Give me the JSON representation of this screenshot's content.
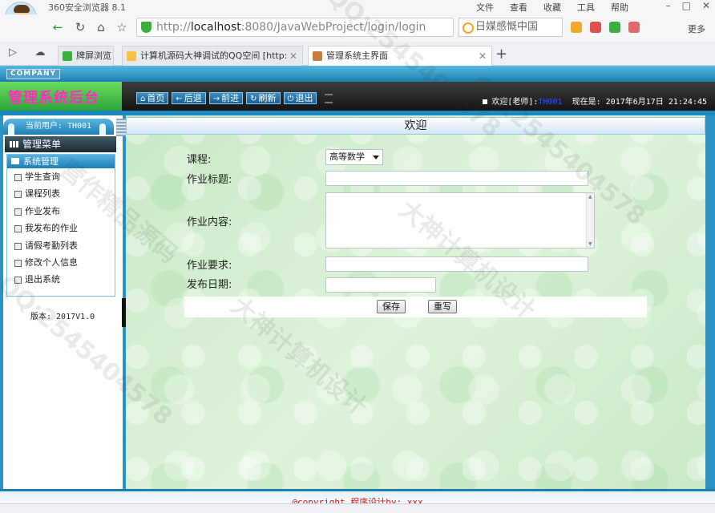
{
  "browser": {
    "title": "360安全浏览器 8.1",
    "menu": [
      "文件",
      "查看",
      "收藏",
      "工具",
      "帮助"
    ],
    "url_scheme": "http://",
    "url_host": "localhost",
    "url_rest": ":8080/JavaWebProject/login/login",
    "search_text": "日媒感慨中国",
    "more_label": "更多",
    "tabs": [
      {
        "label": "牌屏浏览"
      },
      {
        "label": "计算机源码大神调试的QQ空间 [http:"
      },
      {
        "label": "管理系统主界面"
      }
    ]
  },
  "app": {
    "company_badge": "COMPANY",
    "title": "管理系统后台",
    "nav_buttons": [
      {
        "label": "首页",
        "glyph": "⌂"
      },
      {
        "label": "后退",
        "glyph": "←"
      },
      {
        "label": "前进",
        "glyph": "→"
      },
      {
        "label": "刷新",
        "glyph": "↻"
      },
      {
        "label": "退出",
        "glyph": "⏻"
      }
    ],
    "welcome_prefix": "欢迎[老师]:",
    "welcome_user": "TH001",
    "time_label": "现在是: 2017年6月17日 21:24:45"
  },
  "sidebar": {
    "current_user": "当前用户: TH001",
    "menu_title": "管理菜单",
    "section_title": "系统管理",
    "items": [
      "学生查询",
      "课程列表",
      "作业发布",
      "我发布的作业",
      "请假考勤列表",
      "修改个人信息",
      "退出系统"
    ],
    "version": "版本: 2017V1.0"
  },
  "content": {
    "header": "欢迎",
    "form": {
      "course_label": "课程:",
      "course_value": "高等数学",
      "title_label": "作业标题:",
      "title_value": "",
      "body_label": "作业内容:",
      "body_value": "",
      "requirement_label": "作业要求:",
      "requirement_value": "",
      "date_label": "发布日期:",
      "date_value": "",
      "save_label": "保存",
      "reset_label": "重写"
    }
  },
  "footer": {
    "copyright": "@copyright 程序设计by; xxx"
  },
  "watermark": [
    "QQ:2545404578",
    "大神计算机设计",
    "营作精品源码"
  ]
}
